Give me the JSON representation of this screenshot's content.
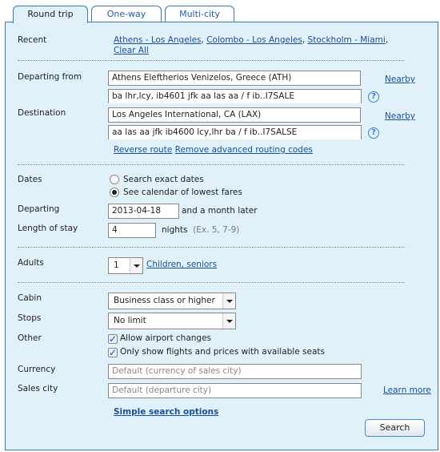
{
  "tabs": [
    {
      "label": "Round trip",
      "active": true
    },
    {
      "label": "One-way"
    },
    {
      "label": "Multi-city"
    }
  ],
  "recent": {
    "label": "Recent",
    "links": [
      "Athens - Los Angeles",
      "Colombo - Los Angeles",
      "Stockholm - Miami"
    ],
    "clear": "Clear All"
  },
  "departing_from": {
    "label": "Departing from",
    "value": "Athens Eleftherios Venizelos, Greece (ATH)",
    "routing": "ba lhr,lcy, ib4601 jfk aa las aa / f ib..I7SALE",
    "nearby": "Nearby"
  },
  "destination": {
    "label": "Destination",
    "value": "Los Angeles International, CA (LAX)",
    "routing": "aa las aa jfk ib4600 lcy,lhr ba / f ib..I7SALSE",
    "nearby": "Nearby"
  },
  "help_glyph": "?",
  "reverse_route": "Reverse route",
  "remove_routing": "Remove advanced routing codes",
  "dates": {
    "label": "Dates",
    "options": [
      "Search exact dates",
      "See calendar of lowest fares"
    ],
    "selected": 1
  },
  "departing": {
    "label": "Departing",
    "value": "2013-04-18",
    "suffix": "and a month later"
  },
  "stay": {
    "label": "Length of stay",
    "value": "4",
    "unit": "nights",
    "hint": "(Ex. 5, 7-9)"
  },
  "adults": {
    "label": "Adults",
    "value": "1",
    "link": "Children, seniors"
  },
  "cabin": {
    "label": "Cabin",
    "value": "Business class or higher"
  },
  "stops": {
    "label": "Stops",
    "value": "No limit"
  },
  "other": {
    "label": "Other",
    "options": [
      {
        "label": "Allow airport changes",
        "checked": true
      },
      {
        "label": "Only show flights and prices with available seats",
        "checked": true
      }
    ]
  },
  "currency": {
    "label": "Currency",
    "placeholder": "Default (currency of sales city)"
  },
  "sales_city": {
    "label": "Sales city",
    "placeholder": "Default (departure city)",
    "link": "Learn more"
  },
  "simple_options": "Simple search options",
  "search_button": "Search",
  "colors": {
    "panel_bg": "#e1f1f9",
    "border": "#3c79b5",
    "link": "#1a4f95"
  }
}
